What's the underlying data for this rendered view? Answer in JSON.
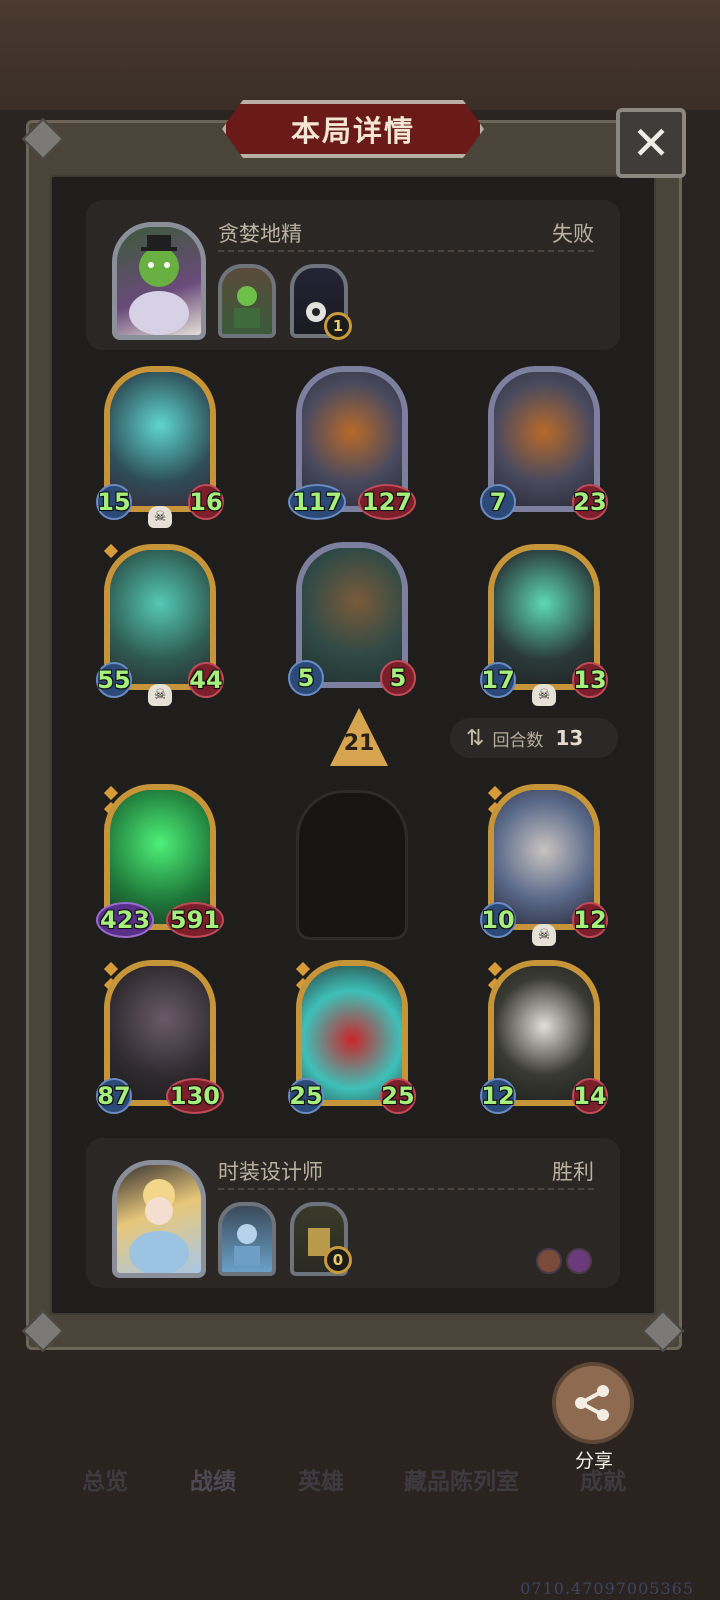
{
  "title": "本局详情",
  "close_icon": "close-icon",
  "opponent": {
    "name": "贪婪地精",
    "result": "失败",
    "mini_badge": "1"
  },
  "player": {
    "name": "时装设计师",
    "result": "胜利",
    "mini_badge": "0"
  },
  "level": "21",
  "round": {
    "label": "回合数",
    "value": "13"
  },
  "opponent_units": [
    {
      "atk": "15",
      "hp": "16"
    },
    {
      "atk": "117",
      "hp": "127"
    },
    {
      "atk": "7",
      "hp": "23"
    },
    {
      "atk": "55",
      "hp": "44"
    },
    {
      "atk": "5",
      "hp": "5"
    },
    {
      "atk": "17",
      "hp": "13"
    }
  ],
  "player_units": [
    {
      "atk": "423",
      "hp": "591"
    },
    {
      "atk": "10",
      "hp": "12"
    },
    {
      "atk": "87",
      "hp": "130"
    },
    {
      "atk": "25",
      "hp": "25"
    },
    {
      "atk": "12",
      "hp": "14"
    }
  ],
  "share_label": "分享",
  "nav": [
    "总览",
    "战绩",
    "英雄",
    "藏品陈列室",
    "成就"
  ],
  "coords": "0710.47097005365"
}
